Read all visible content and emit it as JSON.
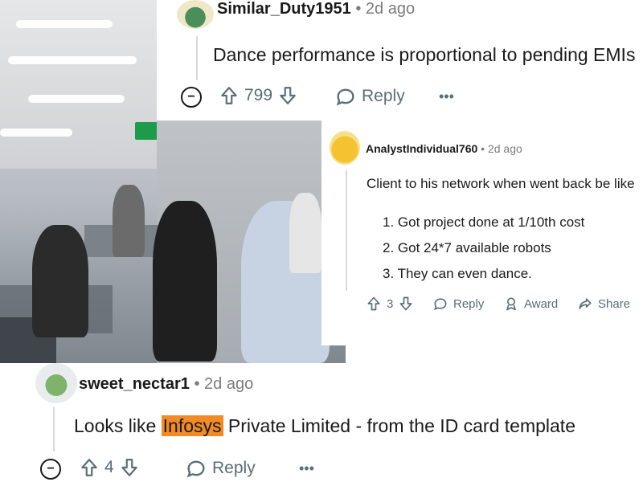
{
  "top_comment": {
    "username": "Similar_Duty1951",
    "separator": "•",
    "age": "2d ago",
    "text": "Dance performance is proportional to pending EMIs",
    "actions": {
      "collapse_symbol": "−",
      "upvote_icon": "upvote-icon",
      "score": "799",
      "downvote_icon": "downvote-icon",
      "reply_label": "Reply",
      "more": "•••"
    }
  },
  "mid_comment": {
    "username": "AnalystIndividual760",
    "separator": "•",
    "age": "2d ago",
    "text": "Client to his network when went back be like",
    "list": [
      "1. Got project done at 1/10th cost",
      "2. Got 24*7 available robots",
      "3. They can even dance."
    ],
    "actions": {
      "score": "3",
      "reply_label": "Reply",
      "award_label": "Award",
      "share_label": "Share"
    }
  },
  "bottom_comment": {
    "username": "sweet_nectar1",
    "separator": "•",
    "age": "2d ago",
    "text_before": "Looks like ",
    "highlight": "Infosys",
    "text_after": " Private Limited - from the ID card template",
    "actions": {
      "collapse_symbol": "−",
      "score": "4",
      "reply_label": "Reply",
      "more": "•••"
    }
  },
  "photo": {
    "exit_sign_text": "⇦ 𝄞 ⇨"
  },
  "colors": {
    "highlight": "#f28a26",
    "muted": "#7c7c7c",
    "text": "#1a1a1b"
  }
}
